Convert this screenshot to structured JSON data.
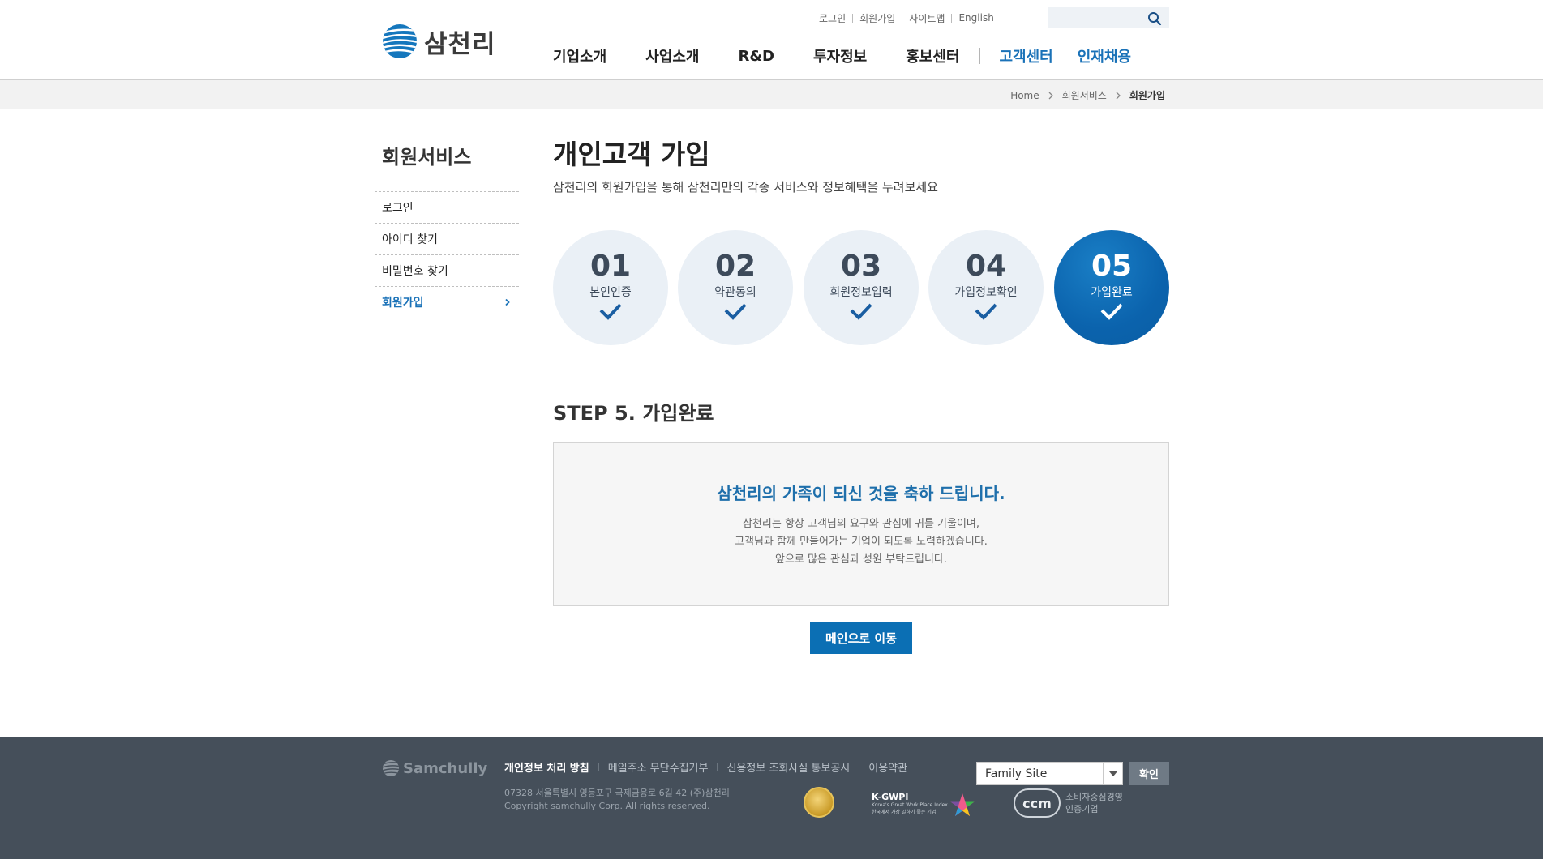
{
  "brand": {
    "logo_text": "삼천리",
    "logo_icon": "globe-stripes-icon",
    "accent": "#0b6fb4"
  },
  "util_links": [
    "로그인",
    "회원가입",
    "사이트맵",
    "English"
  ],
  "search": {
    "placeholder": "",
    "icon": "search-icon"
  },
  "gnb": [
    "기업소개",
    "사업소개",
    "R&D",
    "투자정보",
    "홍보센터",
    "고객센터",
    "인재채용"
  ],
  "breadcrumb": [
    "Home",
    "회원서비스",
    "회원가입"
  ],
  "lnb": {
    "title": "회원서비스",
    "items": [
      "로그인",
      "아이디 찾기",
      "비밀번호 찾기",
      "회원가입"
    ],
    "active": "회원가입"
  },
  "page": {
    "title": "개인고객 가입",
    "desc": "삼천리의 회원가입을 통해 삼천리만의 각종 서비스와 정보혜택을 누려보세요"
  },
  "steps": [
    {
      "num": "01",
      "label": "본인인증"
    },
    {
      "num": "02",
      "label": "약관동의"
    },
    {
      "num": "03",
      "label": "회원정보입력"
    },
    {
      "num": "04",
      "label": "가입정보확인"
    },
    {
      "num": "05",
      "label": "가입완료"
    }
  ],
  "current_step": "05",
  "section_title": "STEP 5. 가입완료",
  "message": {
    "headline": "삼천리의 가족이 되신 것을 축하 드립니다.",
    "lines": [
      "삼천리는 항상 고객님의 요구와 관심에 귀를 기울이며,",
      "고객님과 함께 만들어가는 기업이 되도록 노력하겠습니다.",
      "앞으로 많은 관심과 성원 부탁드립니다."
    ]
  },
  "main_button": "메인으로 이동",
  "footer": {
    "logo_text": "Samchully",
    "links": [
      "개인정보 처리 방침",
      "메일주소 무단수집거부",
      "신용정보 조회사실 통보공시",
      "이용약관"
    ],
    "address": "07328 서울특별시 영등포구 국제금융로 6길 42 (주)삼천리",
    "copyright": "Copyright samchully Corp. All rights reserved.",
    "awards": {
      "kgwpi_title": "K-GWPI",
      "kgwpi_sub1": "Korea's Great Work Place Index",
      "kgwpi_sub2": "한국에서 가장 일하기 좋은 기업",
      "ccm_label": "ccm",
      "ccm_line1": "소비자중심경영",
      "ccm_line2": "인증기업"
    },
    "family_site": "Family Site",
    "family_button": "확인"
  }
}
